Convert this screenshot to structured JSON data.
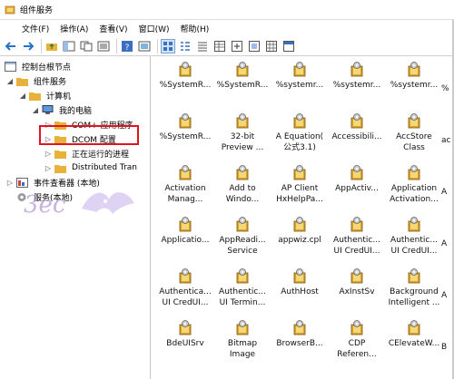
{
  "window": {
    "title": "组件服务"
  },
  "menu": [
    {
      "label": "文件(F)"
    },
    {
      "label": "操作(A)"
    },
    {
      "label": "查看(V)"
    },
    {
      "label": "窗口(W)"
    },
    {
      "label": "帮助(H)"
    }
  ],
  "tree": [
    {
      "label": "控制台根节点",
      "expander": "",
      "icon": "console-root-icon"
    },
    {
      "label": "组件服务",
      "expander": "◢",
      "icon": "folder-icon"
    },
    {
      "label": "计算机",
      "expander": "◢",
      "icon": "folder-icon"
    },
    {
      "label": "我的电脑",
      "expander": "◢",
      "icon": "computer-icon"
    },
    {
      "label": "COM+ 应用程序",
      "expander": "▷",
      "icon": "folder-icon"
    },
    {
      "label": "DCOM 配置",
      "expander": "▷",
      "icon": "folder-icon"
    },
    {
      "label": "正在运行的进程",
      "expander": "▷",
      "icon": "folder-icon"
    },
    {
      "label": "Distributed Tran",
      "expander": "▷",
      "icon": "folder-icon"
    },
    {
      "label": "事件查看器 (本地)",
      "expander": "▷",
      "icon": "event-viewer-icon"
    },
    {
      "label": "服务(本地)",
      "expander": "",
      "icon": "services-icon"
    }
  ],
  "items": [
    [
      "%SystemR...",
      ""
    ],
    [
      "%SystemR...",
      ""
    ],
    [
      "%systemr...",
      ""
    ],
    [
      "%systemr...",
      ""
    ],
    [
      "%systemr...",
      ""
    ],
    [
      "%SystemR...",
      ""
    ],
    [
      "32-bit",
      "Preview ..."
    ],
    [
      "A Equation(",
      "公式3.1)"
    ],
    [
      "Accessibili...",
      ""
    ],
    [
      "AccStore",
      "Class"
    ],
    [
      "Activation",
      "Manag..."
    ],
    [
      "Add to",
      "Windo..."
    ],
    [
      "AP Client",
      "HxHelpPa..."
    ],
    [
      "AppActiv...",
      ""
    ],
    [
      "Application",
      "Activation..."
    ],
    [
      "Applicatio...",
      ""
    ],
    [
      "AppReadi...",
      "Service"
    ],
    [
      "appwiz.cpl",
      ""
    ],
    [
      "Authentic...",
      "UI CredUI..."
    ],
    [
      "Authentic...",
      "UI CredUI..."
    ],
    [
      "Authentica...",
      "UI CredUI..."
    ],
    [
      "Authentic...",
      "UI Termin..."
    ],
    [
      "AuthHost",
      ""
    ],
    [
      "AxInstSv",
      ""
    ],
    [
      "Background",
      "Intelligent ..."
    ],
    [
      "BdeUISrv",
      ""
    ],
    [
      "Bitmap",
      "Image"
    ],
    [
      "BrowserB...",
      ""
    ],
    [
      "CDP",
      "Referen..."
    ],
    [
      "CElevateW...",
      ""
    ]
  ],
  "edge_items": [
    "%",
    "ac",
    "A",
    "A",
    "A",
    "B",
    "B",
    "C"
  ],
  "colors": {
    "highlight": "#e0141e",
    "selected_toolbar": "#cde4f7"
  }
}
